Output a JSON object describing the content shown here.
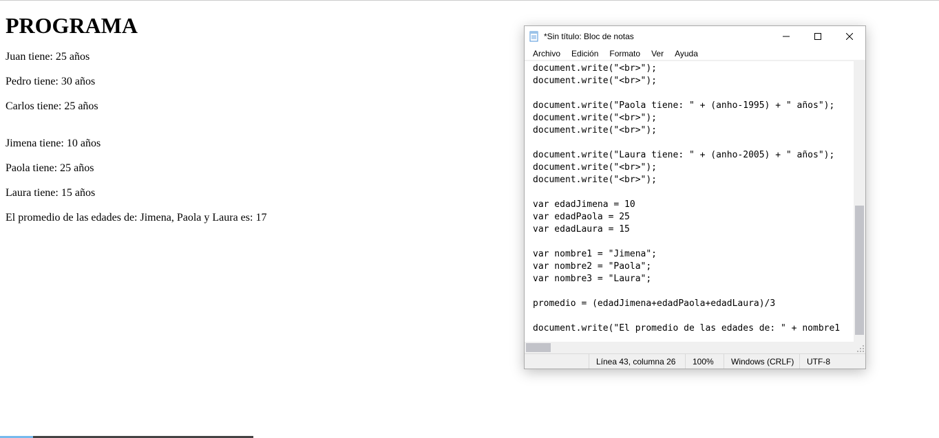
{
  "page": {
    "title": "PROGRAMA",
    "lines": [
      "Juan tiene: 25 años",
      "Pedro tiene: 30 años",
      "Carlos tiene: 25 años",
      "",
      "Jimena tiene: 10 años",
      "Paola tiene: 25 años",
      "Laura tiene: 15 años",
      "El promedio de las edades de: Jimena, Paola y Laura es: 17"
    ]
  },
  "notepad": {
    "title": "*Sin título: Bloc de notas",
    "menus": {
      "file": "Archivo",
      "edit": "Edición",
      "format": "Formato",
      "view": "Ver",
      "help": "Ayuda"
    },
    "code": "document.write(\"<br>\");\ndocument.write(\"<br>\");\n\ndocument.write(\"Paola tiene: \" + (anho-1995) + \" años\");\ndocument.write(\"<br>\");\ndocument.write(\"<br>\");\n\ndocument.write(\"Laura tiene: \" + (anho-2005) + \" años\");\ndocument.write(\"<br>\");\ndocument.write(\"<br>\");\n\nvar edadJimena = 10\nvar edadPaola = 25\nvar edadLaura = 15\n\nvar nombre1 = \"Jimena\";\nvar nombre2 = \"Paola\";\nvar nombre3 = \"Laura\";\n\npromedio = (edadJimena+edadPaola+edadLaura)/3\n\ndocument.write(\"El promedio de las edades de: \" + nombre1",
    "status": {
      "position": "Línea 43, columna 26",
      "zoom": "100%",
      "line_ending": "Windows (CRLF)",
      "encoding": "UTF-8"
    }
  }
}
